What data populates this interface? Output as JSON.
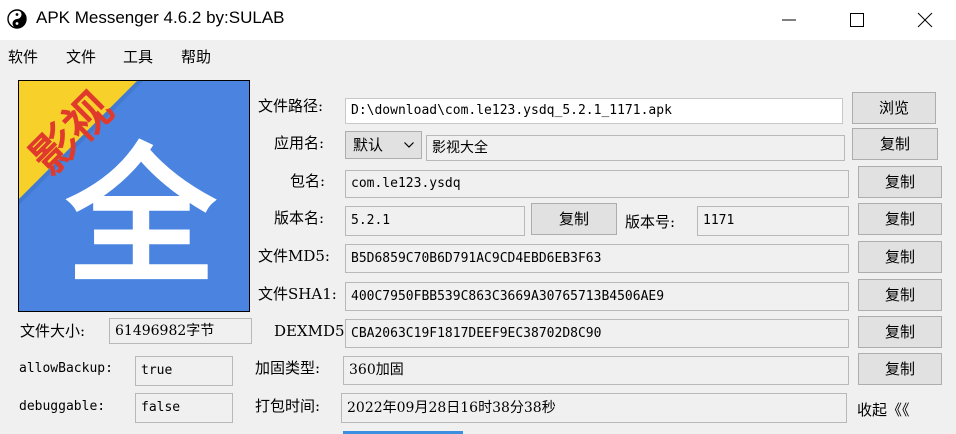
{
  "window": {
    "title": "APK Messenger 4.6.2    by:SULAB"
  },
  "menu": [
    "软件",
    "文件",
    "工具",
    "帮助"
  ],
  "logo": {
    "banner_text": "影视",
    "main_glyph": "全",
    "colors": {
      "background": "#4a84e0",
      "banner": "#f7d02a",
      "banner_text": "#e03a2c",
      "glyph": "#ffffff"
    }
  },
  "fields": {
    "file_path": {
      "label": "文件路径:",
      "value": "D:\\download\\com.le123.ysdq_5.2.1_1171.apk",
      "button": "浏览"
    },
    "app_name": {
      "label": "应用名:",
      "locale": "默认",
      "value": "影视大全",
      "button": "复制"
    },
    "package": {
      "label": "包名:",
      "value": "com.le123.ysdq",
      "button": "复制"
    },
    "version_name": {
      "label": "版本名:",
      "value": "5.2.1",
      "button": "复制"
    },
    "version_code": {
      "label": "版本号:",
      "value": "1171",
      "button": "复制"
    },
    "md5": {
      "label": "文件MD5:",
      "value": "B5D6859C70B6D791AC9CD4EBD6EB3F63",
      "button": "复制"
    },
    "sha1": {
      "label": "文件SHA1:",
      "value": "400C7950FBB539C863C3669A30765713B4506AE9",
      "button": "复制"
    },
    "dexmd5": {
      "label": "DEXMD5:",
      "value": "CBA2063C19F1817DEEF9EC38702D8C90",
      "button": "复制"
    },
    "protect": {
      "label": "加固类型:",
      "value": "360加固",
      "button": "复制"
    },
    "build_time": {
      "label": "打包时间:",
      "value": "2022年09月28日16时38分38秒"
    }
  },
  "left_info": {
    "file_size": {
      "label": "文件大小:",
      "value": "61496982字节"
    },
    "allow_backup": {
      "label": "allowBackup:",
      "value": "true"
    },
    "debuggable": {
      "label": "debuggable:",
      "value": "false"
    }
  },
  "collapse_label": "收起《《"
}
